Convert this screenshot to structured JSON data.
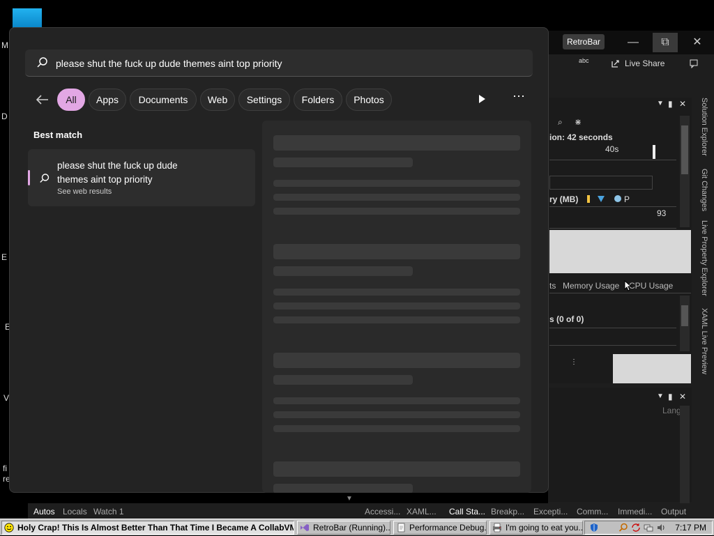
{
  "desktop": {
    "letters": [
      "M",
      "D",
      "E",
      "E",
      "V",
      "fi",
      "re"
    ]
  },
  "vs_window": {
    "title_badge": "RetroBar",
    "toolbar": {
      "live_share": "Live Share",
      "abc": "abc"
    },
    "session_text": "ion: 42 seconds",
    "timeline_label": "40s",
    "memory_header": "ry (MB)",
    "memory_value": "93",
    "legend_p": "P",
    "tabs": [
      "ts",
      "Memory Usage",
      "CPU Usage"
    ],
    "events_text": "s (0 of 0)",
    "lang_label": "Lang",
    "side_tabs": [
      "Solution Explorer",
      "Git Changes",
      "Live Property Explorer",
      "XAML Live Preview"
    ],
    "bottom_tabs_left": [
      "Autos",
      "Locals",
      "Watch 1"
    ],
    "bottom_tabs_right": [
      "Accessi...",
      "XAML...",
      "Call Sta...",
      "Breakp...",
      "Excepti...",
      "Comm...",
      "Immedi...",
      "Output"
    ]
  },
  "search": {
    "query": "please shut the fuck up dude themes aint top priority",
    "filters": [
      "All",
      "Apps",
      "Documents",
      "Web",
      "Settings",
      "Folders",
      "Photos"
    ],
    "active_filter": "All",
    "best_match_label": "Best match",
    "result": {
      "title": "please shut the fuck up dude themes aint top priority",
      "subtitle": "See web results"
    },
    "accent_color": "#e2a7e4"
  },
  "taskbar": {
    "tasks": [
      {
        "label": "Holy Crap! This Is Almost Better Than That Time I Became A CollabVM!",
        "icon": "smiley-icon",
        "active": true
      },
      {
        "label": "RetroBar (Running)...",
        "icon": "visual-studio-icon",
        "active": false
      },
      {
        "label": "Performance Debug...",
        "icon": "document-icon",
        "active": false
      },
      {
        "label": "I'm going to eat you...",
        "icon": "printer-icon",
        "active": false
      }
    ],
    "clock": "7:17 PM"
  }
}
